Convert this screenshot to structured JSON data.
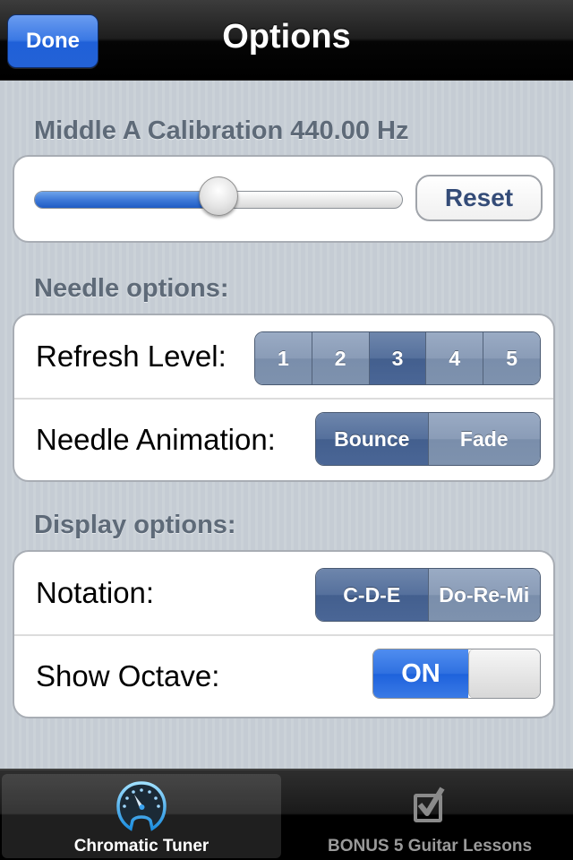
{
  "navbar": {
    "title": "Options",
    "done_label": "Done"
  },
  "calibration": {
    "header": "Middle A Calibration 440.00 Hz",
    "slider_fraction": 0.5,
    "reset_label": "Reset",
    "accent_color": "#3f7ad8"
  },
  "needle": {
    "header": "Needle options:",
    "refresh_label": "Refresh Level:",
    "refresh_options": [
      "1",
      "2",
      "3",
      "4",
      "5"
    ],
    "refresh_selected": "3",
    "animation_label": "Needle Animation:",
    "animation_options": [
      "Bounce",
      "Fade"
    ],
    "animation_selected": "Bounce"
  },
  "display": {
    "header": "Display options:",
    "notation_label": "Notation:",
    "notation_options": [
      "C-D-E",
      "Do-Re-Mi"
    ],
    "notation_selected": "C-D-E",
    "octave_label": "Show Octave:",
    "octave_state": "ON",
    "octave_on": true
  },
  "tabbar": {
    "tabs": [
      {
        "label": "Chromatic Tuner",
        "icon": "gauge-icon",
        "active": true
      },
      {
        "label": "BONUS 5 Guitar Lessons",
        "icon": "checkbox-icon",
        "active": false
      }
    ]
  }
}
